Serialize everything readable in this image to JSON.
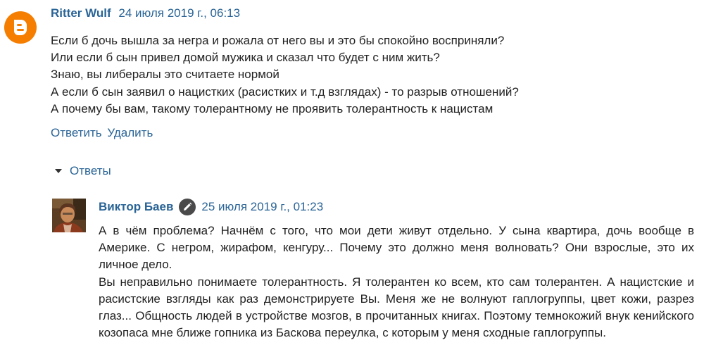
{
  "comment": {
    "author": "Ritter Wulf",
    "timestamp": "24 июля 2019 г., 06:13",
    "avatar_icon": "blogger-logo-icon",
    "avatar_color": "#f57d00",
    "lines": [
      "Если б дочь вышла за негра и рожала от него вы и это бы спокойно восприняли?",
      "Или если б сын привел домой мужика и сказал что будет с ним жить?",
      "Знаю, вы либералы это считаете нормой",
      "А если б сын заявил о нацистких (расистких и т.д взглядах) - то разрыв отношений?",
      "А почему бы вам, такому толерантному не проявить толерантность к нацистам"
    ],
    "actions": {
      "reply": "Ответить",
      "delete": "Удалить"
    }
  },
  "replies_toggle": {
    "label": "Ответы",
    "icon": "caret-down-icon"
  },
  "reply": {
    "author": "Виктор Баев",
    "badge_icon": "pencil-icon",
    "timestamp": "25 июля 2019 г., 01:23",
    "paragraphs": [
      "А в чём проблема? Начнём с того, что мои дети живут отдельно. У сына квартира, дочь вообще в Америке. С негром, жирафом, кенгуру... Почему это должно меня волновать? Они взрослые, это их личное дело.",
      "Вы неправильно понимаете толерантность. Я толерантен ко всем, кто сам толерантен. А нацистские и расистские взгляды как раз демонстрируете Вы. Меня же не волнуют гаплогруппы, цвет кожи, разрез глаз... Общность людей в устройстве мозгов, в прочитанных книгах. Поэтому темнокожий внук кенийского козопаса мне ближе гопника из Баскова переулка, с которым у меня сходные гаплогруппы."
    ]
  },
  "colors": {
    "link": "#2a6496",
    "text": "#222222"
  }
}
